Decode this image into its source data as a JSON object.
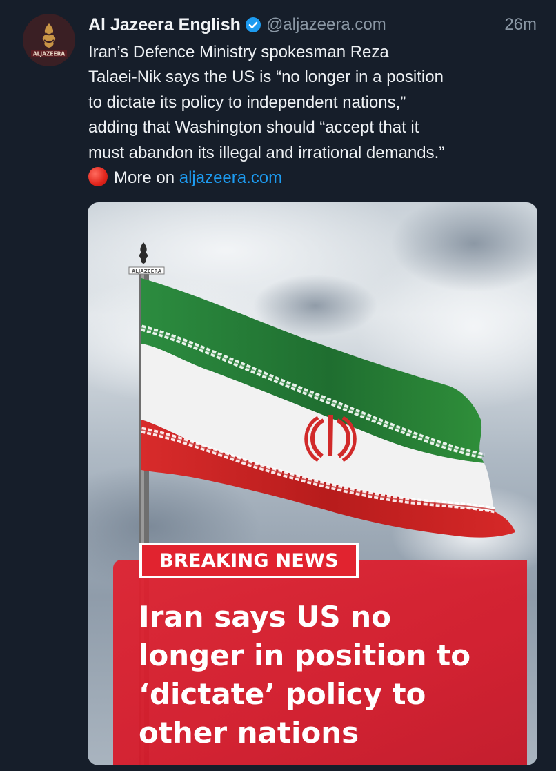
{
  "post": {
    "author_name": "Al Jazeera English",
    "handle": "@aljazeera.com",
    "time": "26m",
    "avatar_text": "ALJAZEERA",
    "body_lines": [
      "Iran’s Defence Ministry spokesman Reza",
      "Talaei-Nik says the US is “no longer in a position",
      "to dictate its policy to independent nations,”",
      "adding that Washington should “accept that it",
      "must abandon its illegal and irrational demands.”"
    ],
    "more_prefix": "More on",
    "more_link": "aljazeera.com"
  },
  "media": {
    "watermark": "ALJAZEERA",
    "badge": "BREAKING NEWS",
    "headline_lines": [
      "Iran says US no",
      "longer in position to",
      "‘dictate’ policy to",
      "other nations"
    ]
  },
  "colors": {
    "background": "#161e2a",
    "link": "#1d9bf0",
    "verified": "#1d9bf0",
    "breaking_red": "#e1232f",
    "flag_green": "#2a8a3c",
    "flag_red": "#d42a2a"
  },
  "icons": [
    "verified-badge-icon",
    "red-circle-icon",
    "aljazeera-logo-icon"
  ]
}
